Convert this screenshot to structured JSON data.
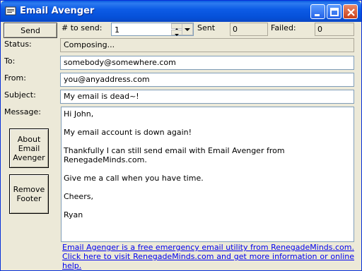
{
  "window": {
    "title": "Email Avenger"
  },
  "toolbar": {
    "send_label": "Send",
    "to_send_label": "# to send:",
    "to_send_value": "1",
    "sent_label": "Sent",
    "sent_value": "0",
    "failed_label": "Failed:",
    "failed_value": "0"
  },
  "form": {
    "status_label": "Status:",
    "status_value": "Composing...",
    "to_label": "To:",
    "to_value": "somebody@somewhere.com",
    "from_label": "From:",
    "from_value": "you@anyaddress.com",
    "subject_label": "Subject:",
    "subject_value": "My email is dead~!",
    "message_label": "Message:"
  },
  "message_lines": [
    "Hi John,",
    "My email account is down again!",
    "Thankfully I can still send email with Email Avenger from RenegadeMinds.com.",
    "Give me a call when you have time.",
    "Cheers,",
    "Ryan"
  ],
  "side_buttons": {
    "about_label": "About Email Avenger",
    "remove_footer_label": "Remove Footer"
  },
  "footer_link": "Email Agenger is a free emergency email utility from RenegadeMinds.com. Click here to visit RenegadeMinds.com and get more information or online help.",
  "colors": {
    "titlebar": "#0550d8",
    "link": "#0000ee",
    "face": "#ece9d8"
  }
}
